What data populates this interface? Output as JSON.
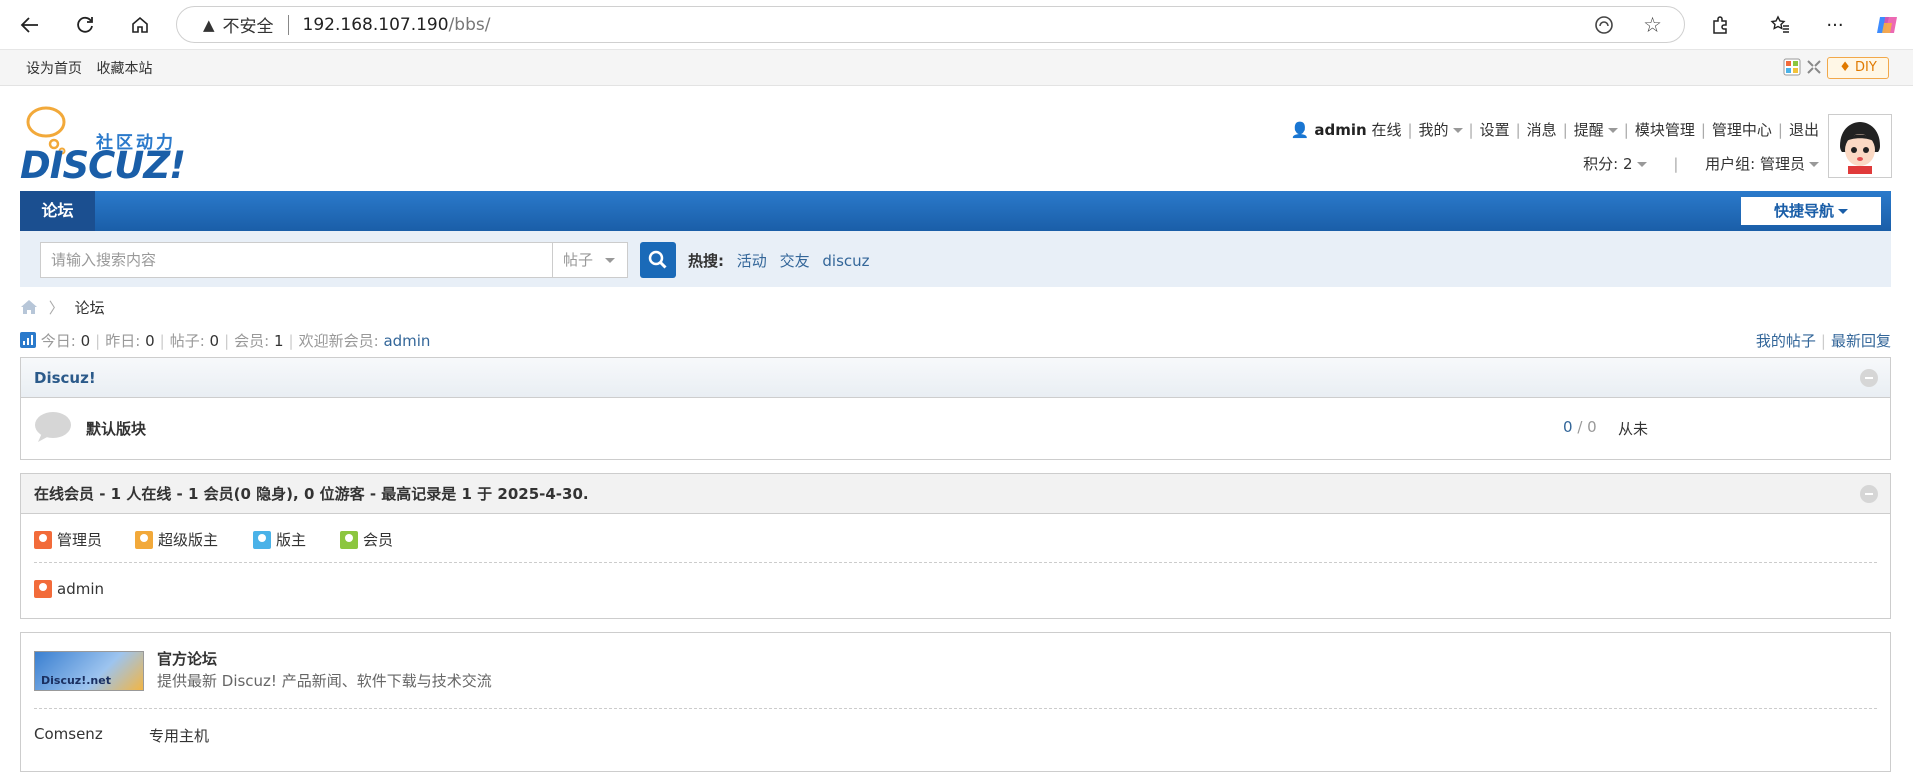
{
  "browser": {
    "not_secure": "不安全",
    "url_host": "192.168.107.190",
    "url_path": "/bbs/"
  },
  "topbar": {
    "set_home": "设为首页",
    "bookmark": "收藏本站",
    "diy": "DIY"
  },
  "logo": {
    "tagline": "社区动力",
    "brand": "DISCUZ!"
  },
  "user": {
    "name": "admin",
    "status": "在线",
    "links": [
      "我的",
      "设置",
      "消息",
      "提醒",
      "模块管理",
      "管理中心",
      "退出"
    ],
    "points": "积分: 2",
    "group": "用户组: 管理员"
  },
  "nav": {
    "current": "论坛",
    "quick_nav": "快捷导航"
  },
  "search": {
    "placeholder": "请输入搜索内容",
    "type": "帖子",
    "hot_label": "热搜:",
    "hot": [
      "活动",
      "交友",
      "discuz"
    ]
  },
  "breadcrumb": {
    "current": "论坛"
  },
  "stats": {
    "today_label": "今日:",
    "today": "0",
    "yesterday_label": "昨日:",
    "yesterday": "0",
    "posts_label": "帖子:",
    "posts": "0",
    "members_label": "会员:",
    "members": "1",
    "welcome_label": "欢迎新会员:",
    "newest": "admin",
    "my_posts": "我的帖子",
    "latest_replies": "最新回复"
  },
  "category": {
    "title": "Discuz!",
    "forum_name": "默认版块",
    "threads": "0",
    "posts": "0",
    "last": "从未"
  },
  "online": {
    "title": "在线会员 - 1 人在线 - 1 会员(0 隐身), 0 位游客 - 最高记录是 1 于 2025-4-30.",
    "legend": [
      "管理员",
      "超级版主",
      "版主",
      "会员"
    ],
    "legend_colors": [
      "#f26b3a",
      "#f2a93a",
      "#4ab2e8",
      "#8cc63f"
    ],
    "users": [
      "admin"
    ]
  },
  "links": {
    "logo_text": "Discuz!.net",
    "title": "官方论坛",
    "desc": "提供最新 Discuz! 产品新闻、软件下载与技术交流",
    "text_links": [
      "Comsenz",
      "专用主机"
    ]
  }
}
